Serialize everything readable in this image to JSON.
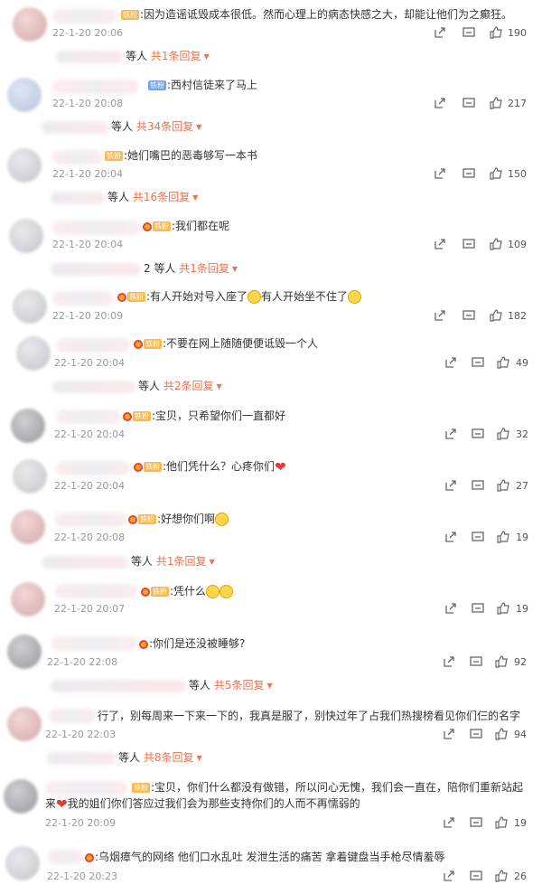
{
  "icons": {
    "share": "share-icon",
    "comment": "comment-icon",
    "like": "thumbs-up-icon",
    "expand": "caret-down-icon"
  },
  "colors": {
    "reply_link": "#eb7350",
    "time": "#999999",
    "badge": "#ffb84d"
  },
  "comments": [
    {
      "badge": "铁粉",
      "text": ":因为造谣诋毁成本很低。然而心理上的病态快感之大，却能让他们为之癫狂。",
      "time": "22-1-20 20:06",
      "likes": "190"
    },
    {
      "badge": "铁粉",
      "text": ":西村信徒来了马上",
      "time": "22-1-20 20:08",
      "likes": "217"
    },
    {
      "badge": "铁粉",
      "text": ":她们嘴巴的恶毒够写一本书",
      "time": "22-1-20 20:04",
      "likes": "150"
    },
    {
      "badge": "铁粉",
      "text": ":我们都在呢",
      "time": "22-1-20 20:04",
      "likes": "109"
    },
    {
      "badge": "铁粉",
      "text": ":有人开始对号入座了",
      "text2": "有人开始坐不住了",
      "time": "22-1-20 20:09",
      "likes": "182"
    },
    {
      "badge": "铁粉",
      "text": ":不要在网上随随便便诋毁一个人",
      "time": "22-1-20 20:04",
      "likes": "49"
    },
    {
      "badge": "铁粉",
      "text": ":宝贝，只希望你们一直都好",
      "time": "22-1-20 20:04",
      "likes": "32"
    },
    {
      "badge": "铁粉",
      "text": ":他们凭什么？心疼你们",
      "time": "22-1-20 20:04",
      "likes": "27"
    },
    {
      "badge": "铁粉",
      "text": ":好想你们啊",
      "time": "22-1-20 20:08",
      "likes": "19"
    },
    {
      "badge": "铁粉",
      "text": ":凭什么",
      "time": "22-1-20 20:07",
      "likes": "19"
    },
    {
      "badge": "",
      "text": ":你们是还没被睡够?",
      "time": "22-1-20 22:08",
      "likes": "92"
    },
    {
      "badge": "",
      "text": "行了，别每周来一下来一下的，我真是服了，别快过年了占我们热搜榜看见你们仨的名字",
      "time": "22-1-20 22:03",
      "likes": "94"
    },
    {
      "badge": "铁粉",
      "text": ":宝贝，你们什么都没有做错，所以问心无愧，我们会一直在，陪你们重新站起",
      "text2": "我的姐们你们答应过我们会为那些支持你们的人而不再懦弱的",
      "text2_prefix": "来",
      "time": "22-1-20 20:09",
      "likes": "19"
    },
    {
      "badge": "",
      "text": ":乌烟瘴气的网络 他们口水乱吐 发泄生活的痛苦 拿着键盘当手枪尽情羞辱",
      "time": "22-1-20 20:23",
      "likes": "26"
    }
  ],
  "replies": [
    {
      "suffix": "等人",
      "count": "共1条回复"
    },
    {
      "suffix": "等人",
      "count": "共34条回复"
    },
    {
      "suffix": "等人",
      "count": "共16条回复"
    },
    {
      "suffix": "2 等人",
      "count": "共1条回复"
    },
    {
      "suffix": "等人",
      "count": "共2条回复"
    },
    {
      "suffix": "等人",
      "count": "共1条回复"
    },
    {
      "suffix": "等人",
      "count": "共5条回复"
    },
    {
      "suffix": "等人",
      "count": "共8条回复"
    }
  ]
}
